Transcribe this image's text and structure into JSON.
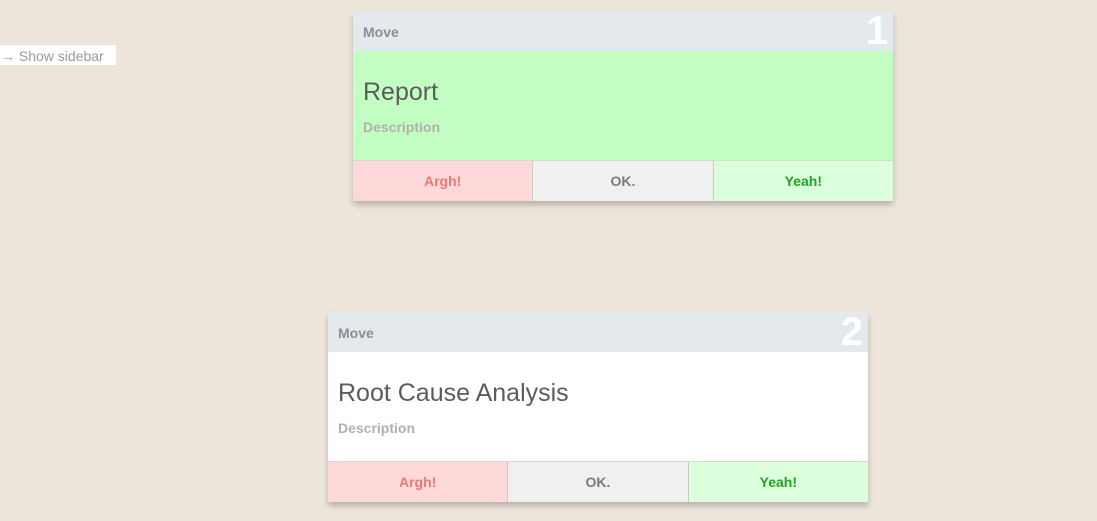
{
  "sidebar_toggle": {
    "arrow": "→",
    "label": "Show sidebar"
  },
  "cards": [
    {
      "number": "1",
      "move_label": "Move",
      "title": "Report",
      "description": "Description",
      "actions": {
        "argh": "Argh!",
        "ok": "OK.",
        "yeah": "Yeah!"
      }
    },
    {
      "number": "2",
      "move_label": "Move",
      "title": "Root Cause Analysis",
      "description": "Description",
      "actions": {
        "argh": "Argh!",
        "ok": "OK.",
        "yeah": "Yeah!"
      }
    }
  ],
  "colors": {
    "background": "#ede5da",
    "header": "#e3e9ec",
    "active_body": "#c3fec3",
    "argh_bg": "#ffd9d9",
    "argh_text": "#ee7777",
    "ok_bg": "#f0f0f0",
    "yeah_bg": "#dcffdc",
    "yeah_text": "#22a222"
  }
}
